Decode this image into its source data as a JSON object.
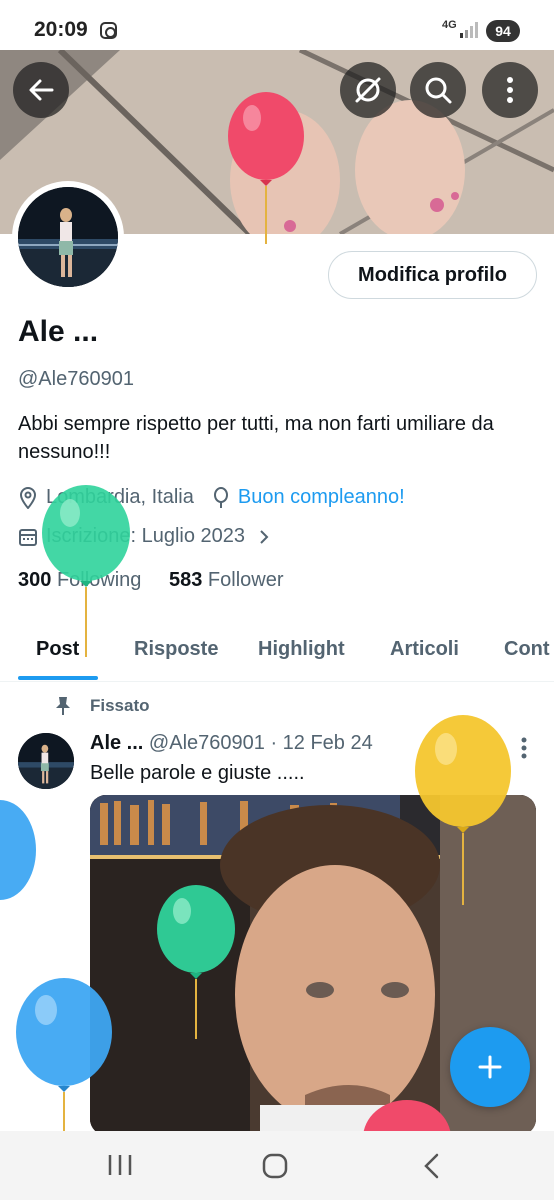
{
  "status_bar": {
    "time": "20:09",
    "network": "4G",
    "battery": "94"
  },
  "profile": {
    "edit_button": "Modifica profilo",
    "name": "Ale ...",
    "handle": "@Ale760901",
    "bio": "Abbi sempre rispetto per tutti, ma non farti umiliare da nessuno!!!",
    "location": "Lombardia, Italia",
    "birthday": "Buon compleanno!",
    "joined": "Iscrizione: Luglio 2023",
    "following_count": "300",
    "following_label": "Following",
    "followers_count": "583",
    "followers_label": "Follower"
  },
  "tabs": [
    "Post",
    "Risposte",
    "Highlight",
    "Articoli",
    "Cont"
  ],
  "pinned_tweet": {
    "pinned_label": "Fissato",
    "author_name": "Ale ...",
    "author_handle": "@Ale760901",
    "date": "· 12 Feb 24",
    "text": "Belle parole e giuste ....."
  },
  "icons": {
    "back": "back-arrow-icon",
    "grok": "grok-icon",
    "search": "search-icon",
    "more": "more-vertical-icon",
    "location": "location-pin-icon",
    "birthday": "balloon-icon",
    "calendar": "calendar-icon",
    "pin": "pin-icon",
    "compose": "plus-icon"
  },
  "colors": {
    "accent": "#1d9bf0",
    "text": "#0f1419",
    "secondary": "#536471"
  }
}
